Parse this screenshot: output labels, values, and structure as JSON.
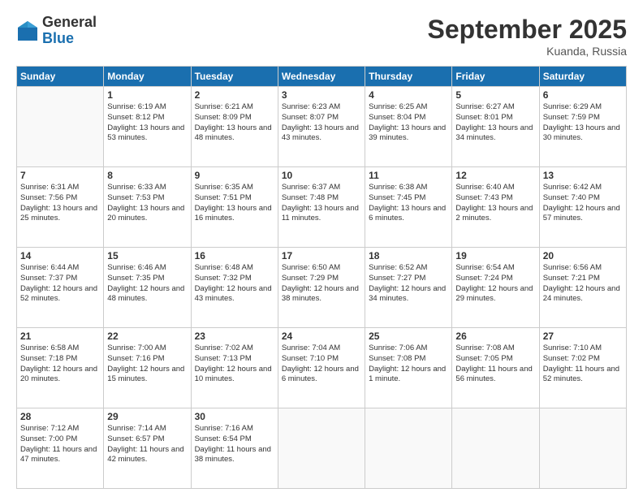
{
  "logo": {
    "general": "General",
    "blue": "Blue"
  },
  "header": {
    "month": "September 2025",
    "location": "Kuanda, Russia"
  },
  "weekdays": [
    "Sunday",
    "Monday",
    "Tuesday",
    "Wednesday",
    "Thursday",
    "Friday",
    "Saturday"
  ],
  "weeks": [
    [
      {
        "day": "",
        "empty": true
      },
      {
        "day": "1",
        "sunrise": "6:19 AM",
        "sunset": "8:12 PM",
        "daylight": "13 hours and 53 minutes."
      },
      {
        "day": "2",
        "sunrise": "6:21 AM",
        "sunset": "8:09 PM",
        "daylight": "13 hours and 48 minutes."
      },
      {
        "day": "3",
        "sunrise": "6:23 AM",
        "sunset": "8:07 PM",
        "daylight": "13 hours and 43 minutes."
      },
      {
        "day": "4",
        "sunrise": "6:25 AM",
        "sunset": "8:04 PM",
        "daylight": "13 hours and 39 minutes."
      },
      {
        "day": "5",
        "sunrise": "6:27 AM",
        "sunset": "8:01 PM",
        "daylight": "13 hours and 34 minutes."
      },
      {
        "day": "6",
        "sunrise": "6:29 AM",
        "sunset": "7:59 PM",
        "daylight": "13 hours and 30 minutes."
      }
    ],
    [
      {
        "day": "7",
        "sunrise": "6:31 AM",
        "sunset": "7:56 PM",
        "daylight": "13 hours and 25 minutes."
      },
      {
        "day": "8",
        "sunrise": "6:33 AM",
        "sunset": "7:53 PM",
        "daylight": "13 hours and 20 minutes."
      },
      {
        "day": "9",
        "sunrise": "6:35 AM",
        "sunset": "7:51 PM",
        "daylight": "13 hours and 16 minutes."
      },
      {
        "day": "10",
        "sunrise": "6:37 AM",
        "sunset": "7:48 PM",
        "daylight": "13 hours and 11 minutes."
      },
      {
        "day": "11",
        "sunrise": "6:38 AM",
        "sunset": "7:45 PM",
        "daylight": "13 hours and 6 minutes."
      },
      {
        "day": "12",
        "sunrise": "6:40 AM",
        "sunset": "7:43 PM",
        "daylight": "13 hours and 2 minutes."
      },
      {
        "day": "13",
        "sunrise": "6:42 AM",
        "sunset": "7:40 PM",
        "daylight": "12 hours and 57 minutes."
      }
    ],
    [
      {
        "day": "14",
        "sunrise": "6:44 AM",
        "sunset": "7:37 PM",
        "daylight": "12 hours and 52 minutes."
      },
      {
        "day": "15",
        "sunrise": "6:46 AM",
        "sunset": "7:35 PM",
        "daylight": "12 hours and 48 minutes."
      },
      {
        "day": "16",
        "sunrise": "6:48 AM",
        "sunset": "7:32 PM",
        "daylight": "12 hours and 43 minutes."
      },
      {
        "day": "17",
        "sunrise": "6:50 AM",
        "sunset": "7:29 PM",
        "daylight": "12 hours and 38 minutes."
      },
      {
        "day": "18",
        "sunrise": "6:52 AM",
        "sunset": "7:27 PM",
        "daylight": "12 hours and 34 minutes."
      },
      {
        "day": "19",
        "sunrise": "6:54 AM",
        "sunset": "7:24 PM",
        "daylight": "12 hours and 29 minutes."
      },
      {
        "day": "20",
        "sunrise": "6:56 AM",
        "sunset": "7:21 PM",
        "daylight": "12 hours and 24 minutes."
      }
    ],
    [
      {
        "day": "21",
        "sunrise": "6:58 AM",
        "sunset": "7:18 PM",
        "daylight": "12 hours and 20 minutes."
      },
      {
        "day": "22",
        "sunrise": "7:00 AM",
        "sunset": "7:16 PM",
        "daylight": "12 hours and 15 minutes."
      },
      {
        "day": "23",
        "sunrise": "7:02 AM",
        "sunset": "7:13 PM",
        "daylight": "12 hours and 10 minutes."
      },
      {
        "day": "24",
        "sunrise": "7:04 AM",
        "sunset": "7:10 PM",
        "daylight": "12 hours and 6 minutes."
      },
      {
        "day": "25",
        "sunrise": "7:06 AM",
        "sunset": "7:08 PM",
        "daylight": "12 hours and 1 minute."
      },
      {
        "day": "26",
        "sunrise": "7:08 AM",
        "sunset": "7:05 PM",
        "daylight": "11 hours and 56 minutes."
      },
      {
        "day": "27",
        "sunrise": "7:10 AM",
        "sunset": "7:02 PM",
        "daylight": "11 hours and 52 minutes."
      }
    ],
    [
      {
        "day": "28",
        "sunrise": "7:12 AM",
        "sunset": "7:00 PM",
        "daylight": "11 hours and 47 minutes."
      },
      {
        "day": "29",
        "sunrise": "7:14 AM",
        "sunset": "6:57 PM",
        "daylight": "11 hours and 42 minutes."
      },
      {
        "day": "30",
        "sunrise": "7:16 AM",
        "sunset": "6:54 PM",
        "daylight": "11 hours and 38 minutes."
      },
      {
        "day": "",
        "empty": true
      },
      {
        "day": "",
        "empty": true
      },
      {
        "day": "",
        "empty": true
      },
      {
        "day": "",
        "empty": true
      }
    ]
  ],
  "labels": {
    "sunrise": "Sunrise:",
    "sunset": "Sunset:",
    "daylight": "Daylight:"
  }
}
